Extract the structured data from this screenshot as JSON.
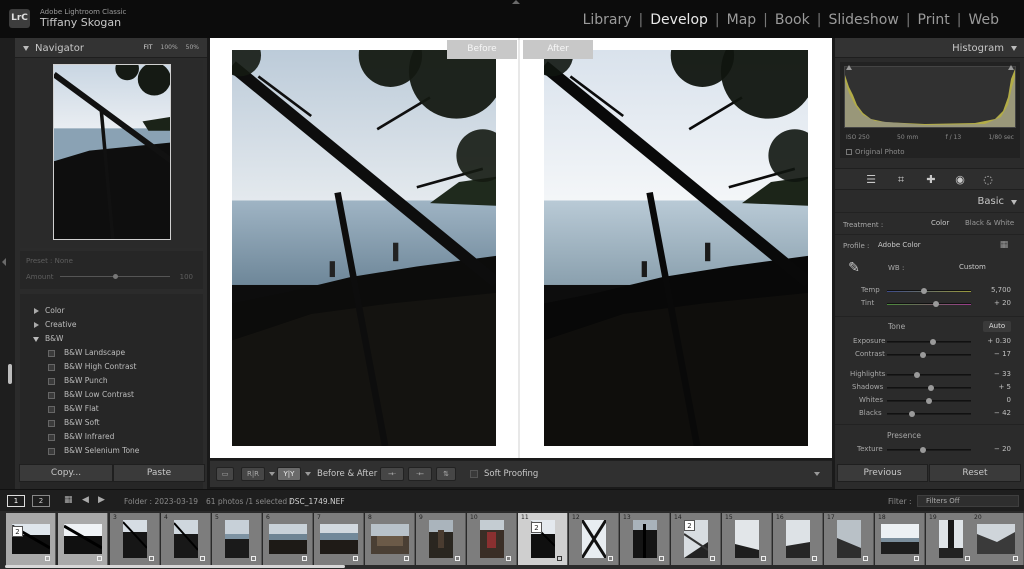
{
  "app": {
    "badge": "LrC",
    "name": "Adobe Lightroom Classic",
    "user": "Tiffany Skogan"
  },
  "modules": [
    "Library",
    "Develop",
    "Map",
    "Book",
    "Slideshow",
    "Print",
    "Web"
  ],
  "active_module": "Develop",
  "navigator": {
    "title": "Navigator",
    "zoom": [
      "FIT",
      "100%",
      "50%"
    ]
  },
  "preset_box": {
    "preset": "Preset : None",
    "amount_label": "Amount",
    "amount_value": "100",
    "amount": 0.62
  },
  "presets": {
    "groups": [
      "Color",
      "Creative",
      "B&W"
    ],
    "bw_items": [
      "B&W Landscape",
      "B&W High Contrast",
      "B&W Punch",
      "B&W Low Contrast",
      "B&W Flat",
      "B&W Soft",
      "B&W Infrared",
      "B&W Selenium Tone"
    ]
  },
  "left_buttons": {
    "copy": "Copy...",
    "paste": "Paste"
  },
  "compare": {
    "before": "Before",
    "after": "After"
  },
  "toolbar": {
    "view_label": "Before & After :",
    "soft_proofing": "Soft Proofing"
  },
  "histogram": {
    "title": "Histogram",
    "exif": [
      "ISO 250",
      "50 mm",
      "f / 13",
      "1/80 sec"
    ],
    "original_photo": "Original Photo"
  },
  "basic": {
    "title": "Basic",
    "treatment_label": "Treatment :",
    "color": "Color",
    "bw": "Black & White",
    "profile_label": "Profile :",
    "profile_value": "Adobe Color",
    "wb_label": "WB :",
    "wb_value": "Custom",
    "tone_label": "Tone",
    "auto": "Auto",
    "presence_label": "Presence",
    "sliders": [
      {
        "label": "Temp",
        "value": "5,700",
        "pos": 0.44
      },
      {
        "label": "Tint",
        "value": "+ 20",
        "pos": 0.58
      },
      {
        "label": "Exposure",
        "value": "+ 0.30",
        "pos": 0.53
      },
      {
        "label": "Contrast",
        "value": "− 17",
        "pos": 0.41
      },
      {
        "label": "Highlights",
        "value": "− 33",
        "pos": 0.35
      },
      {
        "label": "Shadows",
        "value": "+ 5",
        "pos": 0.52
      },
      {
        "label": "Whites",
        "value": "0",
        "pos": 0.5
      },
      {
        "label": "Blacks",
        "value": "− 42",
        "pos": 0.29
      },
      {
        "label": "Texture",
        "value": "− 20",
        "pos": 0.43
      }
    ]
  },
  "right_buttons": {
    "previous": "Previous",
    "reset": "Reset"
  },
  "filmbar": {
    "pages": [
      "1",
      "2"
    ],
    "folder": "Folder : 2023-03-19",
    "count": "61 photos /1 selected /",
    "filename": "DSC_1749.NEF",
    "filter_label": "Filter :",
    "filter_value": "Filters Off"
  },
  "filmstrip": {
    "numbers": [
      "",
      "",
      "3",
      "4",
      "5",
      "6",
      "7",
      "8",
      "9",
      "10",
      "11",
      "12",
      "13",
      "14",
      "15",
      "16",
      "17",
      "18",
      "19",
      "20"
    ],
    "stack_badges": [
      "2",
      "",
      "",
      "",
      "",
      "",
      "",
      "",
      "",
      "",
      "2",
      "",
      "",
      "2",
      "",
      "",
      "",
      "",
      "",
      ""
    ]
  },
  "colors": {
    "accent_white": "#e8e8e8",
    "panel": "#2b2b2b",
    "histogram_yellow": "#d8d24a"
  }
}
